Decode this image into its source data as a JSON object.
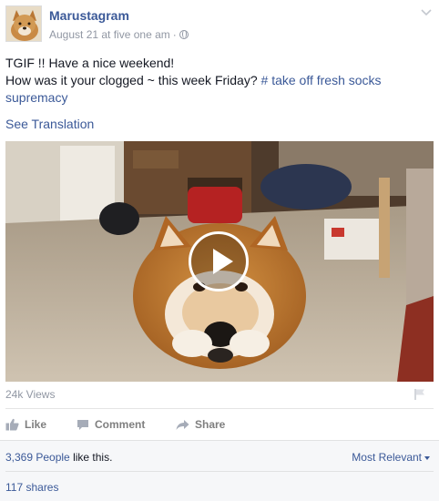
{
  "post": {
    "author": "Marustagram",
    "timestamp": "August 21 at five one am",
    "separator": "·",
    "privacy_icon": "globe-icon",
    "line1": "TGIF !! Have a nice weekend!",
    "line2": "How was it your clogged ~ this week Friday?",
    "hashtag": "# take off fresh socks supremacy",
    "see_translation": "See Translation",
    "options_icon": "chevron-down-icon"
  },
  "video": {
    "play_icon": "play-icon",
    "views": "24k Views",
    "flag_icon": "flag-icon"
  },
  "actions": {
    "like": "Like",
    "comment": "Comment",
    "share": "Share"
  },
  "social": {
    "likes_count": "3,369 People",
    "likes_suffix": " like this.",
    "sort_label": "Most Relevant",
    "shares": "117 shares"
  },
  "colors": {
    "link": "#3b5998",
    "meta": "#9197a3",
    "footer_bg": "#f6f7f9"
  }
}
